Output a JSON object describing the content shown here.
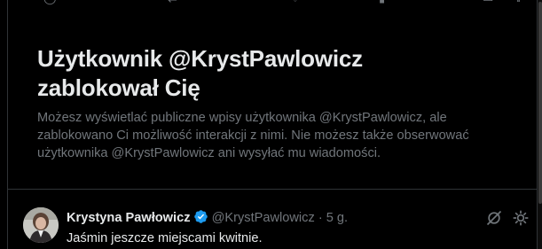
{
  "blocked_notice": {
    "title": "Użytkownik @KrystPawlowicz zablokował Cię",
    "body": "Możesz wyświetlać publiczne wpisy użytkownika @KrystPawlowicz, ale zablokowano Ci możliwość interakcji z nimi. Nie możesz także obserwować użytkownika @KrystPawlowicz ani wysyłać mu wiadomości."
  },
  "tweet": {
    "name": "Krystyna Pawłowicz",
    "handle": "@KrystPawlowicz",
    "separator": "·",
    "time": "5 g.",
    "text": "Jaśmin jeszcze miejscami kwitnie.",
    "verified_icon": "verified-badge-icon",
    "icons": [
      "grok-icon",
      "more-icon"
    ]
  },
  "colors": {
    "background": "#000000",
    "primary_text": "#e7e9ea",
    "secondary_text": "#71767b",
    "border": "#2f3336",
    "verified": "#1d9bf0"
  }
}
